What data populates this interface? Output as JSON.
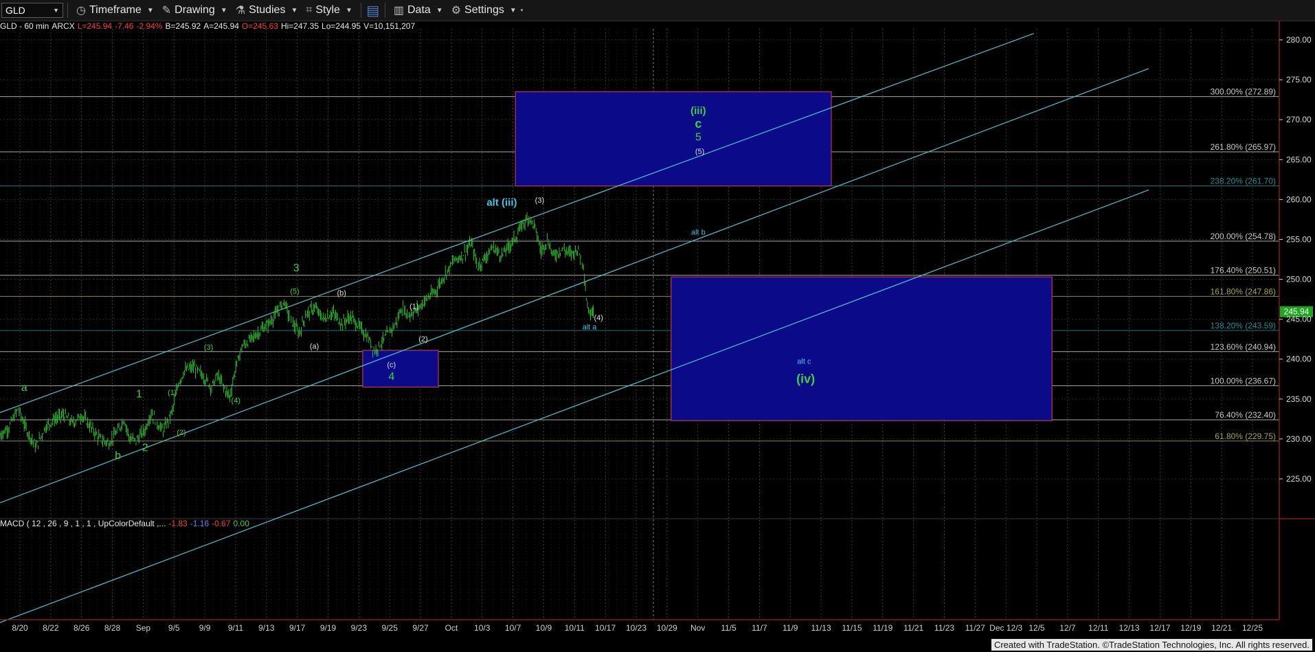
{
  "toolbar": {
    "symbol": "GLD",
    "timeframe": "Timeframe",
    "drawing": "Drawing",
    "studies": "Studies",
    "style": "Style",
    "data": "Data",
    "settings": "Settings"
  },
  "quote": {
    "name": "GLD - 60 min",
    "exchange": "ARCX",
    "last": "L=245.94",
    "change": "-7.46",
    "change_pct": "-2.94%",
    "bid": "B=245.92",
    "ask": "A=245.94",
    "open": "O=245.63",
    "high": "Hi=247.35",
    "low": "Lo=244.95",
    "volume": "V=10,151,207"
  },
  "macd": {
    "label": "MACD ( 12 , 26 , 9 , 1 , 1 , UpColorDefault ,...",
    "v1": "-1.83",
    "v2": "-1.16",
    "v3": "-0.67",
    "v4": "0.00"
  },
  "watermark": "Created with TradeStation. ©TradeStation Technologies, Inc. All rights reserved.",
  "chart_data": {
    "type": "line",
    "symbol": "GLD",
    "interval": "60 min",
    "ylim": [
      220,
      282
    ],
    "y_ticks": [
      "280.00",
      "275.00",
      "270.00",
      "265.00",
      "260.00",
      "255.00",
      "250.00",
      "245.00",
      "240.00",
      "235.00",
      "230.00",
      "225.00"
    ],
    "last_price_label": "245.94",
    "x_tick_labels": [
      "8/20",
      "8/22",
      "8/26",
      "8/28",
      "Sep",
      "9/5",
      "9/9",
      "9/11",
      "9/13",
      "9/17",
      "9/19",
      "9/23",
      "9/25",
      "9/27",
      "Oct",
      "10/3",
      "10/7",
      "10/9",
      "10/11",
      "10/17",
      "10/23",
      "10/29",
      "Nov",
      "11/5",
      "11/7",
      "11/9",
      "11/13",
      "11/15",
      "11/19",
      "11/21",
      "11/23",
      "11/27",
      "Dec 12/3",
      "12/5",
      "12/7",
      "12/11",
      "12/13",
      "12/17",
      "12/19",
      "12/21",
      "12/25"
    ],
    "fib_levels": [
      {
        "label": "300.00% (272.89)",
        "price": 272.89,
        "color": "#c8c8c8"
      },
      {
        "label": "261.80% (265.97)",
        "price": 265.97,
        "color": "#c8c8c8"
      },
      {
        "label": "238.20% (261.70)",
        "price": 261.7,
        "color": "#1f8f8f"
      },
      {
        "label": "200.00% (254.78)",
        "price": 254.78,
        "color": "#c8c8c8"
      },
      {
        "label": "176.40% (250.51)",
        "price": 250.51,
        "color": "#c8c8c8"
      },
      {
        "label": "161.80% (247.86)",
        "price": 247.86,
        "color": "#a6a64a"
      },
      {
        "label": "138.20% (243.59)",
        "price": 243.59,
        "color": "#1f8f8f"
      },
      {
        "label": "123.60% (240.94)",
        "price": 240.94,
        "color": "#c8c8c8"
      },
      {
        "label": "100.00% (236.67)",
        "price": 236.67,
        "color": "#c8c8c8"
      },
      {
        "label": "76.40% (232.40)",
        "price": 232.4,
        "color": "#c8c8c8"
      },
      {
        "label": "61.80% (229.75)",
        "price": 229.75,
        "color": "#a6a64a"
      }
    ],
    "price_path": [
      {
        "t": 0,
        "p": 230.5
      },
      {
        "t": 6,
        "p": 231.5
      },
      {
        "t": 12,
        "p": 233.8
      },
      {
        "t": 18,
        "p": 231.0
      },
      {
        "t": 24,
        "p": 229.0
      },
      {
        "t": 30,
        "p": 231.5
      },
      {
        "t": 36,
        "p": 232.5
      },
      {
        "t": 42,
        "p": 233.0
      },
      {
        "t": 48,
        "p": 232.0
      },
      {
        "t": 54,
        "p": 233.0
      },
      {
        "t": 60,
        "p": 231.5
      },
      {
        "t": 66,
        "p": 230.0
      },
      {
        "t": 72,
        "p": 229.5
      },
      {
        "t": 78,
        "p": 231.0
      },
      {
        "t": 82,
        "p": 232.5
      },
      {
        "t": 86,
        "p": 230.0
      },
      {
        "t": 90,
        "p": 229.8
      },
      {
        "t": 96,
        "p": 231.2
      },
      {
        "t": 100,
        "p": 233.3
      },
      {
        "t": 104,
        "p": 232.0
      },
      {
        "t": 108,
        "p": 231.0
      },
      {
        "t": 114,
        "p": 233.5
      },
      {
        "t": 118,
        "p": 237.0
      },
      {
        "t": 122,
        "p": 238.5
      },
      {
        "t": 128,
        "p": 239.0
      },
      {
        "t": 134,
        "p": 238.0
      },
      {
        "t": 140,
        "p": 236.5
      },
      {
        "t": 144,
        "p": 238.0
      },
      {
        "t": 148,
        "p": 236.5
      },
      {
        "t": 152,
        "p": 235.3
      },
      {
        "t": 156,
        "p": 239.0
      },
      {
        "t": 160,
        "p": 241.5
      },
      {
        "t": 166,
        "p": 242.5
      },
      {
        "t": 172,
        "p": 243.5
      },
      {
        "t": 178,
        "p": 244.5
      },
      {
        "t": 184,
        "p": 246.0
      },
      {
        "t": 188,
        "p": 247.3
      },
      {
        "t": 192,
        "p": 245.0
      },
      {
        "t": 198,
        "p": 243.2
      },
      {
        "t": 202,
        "p": 245.5
      },
      {
        "t": 208,
        "p": 246.5
      },
      {
        "t": 214,
        "p": 245.0
      },
      {
        "t": 220,
        "p": 245.8
      },
      {
        "t": 226,
        "p": 244.5
      },
      {
        "t": 232,
        "p": 245.3
      },
      {
        "t": 238,
        "p": 244.0
      },
      {
        "t": 244,
        "p": 242.5
      },
      {
        "t": 248,
        "p": 241.0
      },
      {
        "t": 252,
        "p": 242.0
      },
      {
        "t": 256,
        "p": 243.0
      },
      {
        "t": 262,
        "p": 244.5
      },
      {
        "t": 266,
        "p": 246.5
      },
      {
        "t": 270,
        "p": 245.5
      },
      {
        "t": 276,
        "p": 246.2
      },
      {
        "t": 282,
        "p": 247.5
      },
      {
        "t": 288,
        "p": 248.5
      },
      {
        "t": 294,
        "p": 250.5
      },
      {
        "t": 300,
        "p": 252.3
      },
      {
        "t": 306,
        "p": 253.0
      },
      {
        "t": 312,
        "p": 254.5
      },
      {
        "t": 316,
        "p": 251.5
      },
      {
        "t": 320,
        "p": 252.5
      },
      {
        "t": 326,
        "p": 254.0
      },
      {
        "t": 332,
        "p": 253.0
      },
      {
        "t": 338,
        "p": 254.5
      },
      {
        "t": 342,
        "p": 255.5
      },
      {
        "t": 346,
        "p": 257.0
      },
      {
        "t": 350,
        "p": 257.8
      },
      {
        "t": 354,
        "p": 256.5
      },
      {
        "t": 358,
        "p": 253.5
      },
      {
        "t": 362,
        "p": 255.0
      },
      {
        "t": 366,
        "p": 253.0
      },
      {
        "t": 372,
        "p": 253.8
      },
      {
        "t": 378,
        "p": 253.2
      },
      {
        "t": 382,
        "p": 253.8
      },
      {
        "t": 386,
        "p": 252.0
      },
      {
        "t": 388,
        "p": 247.5
      },
      {
        "t": 390,
        "p": 245.5
      },
      {
        "t": 392,
        "p": 246.5
      },
      {
        "t": 393,
        "p": 245.94
      }
    ],
    "wave_labels": [
      {
        "text": "a",
        "t": 16,
        "p": 236.0,
        "color": "#3ecf3e",
        "size": 16
      },
      {
        "text": "b",
        "t": 78,
        "p": 227.5,
        "color": "#3ecf3e",
        "size": 16
      },
      {
        "text": "1",
        "t": 92,
        "p": 235.2,
        "color": "#3ecf3e",
        "size": 16
      },
      {
        "text": "2",
        "t": 96,
        "p": 228.5,
        "color": "#3ecf3e",
        "size": 16
      },
      {
        "text": "(1)",
        "t": 114,
        "p": 235.5,
        "color": "#3ecf3e",
        "size": 11
      },
      {
        "text": "(2)",
        "t": 120,
        "p": 230.5,
        "color": "#3ecf3e",
        "size": 11
      },
      {
        "text": "(3)",
        "t": 138,
        "p": 241.2,
        "color": "#3ecf3e",
        "size": 11
      },
      {
        "text": "(4)",
        "t": 156,
        "p": 234.5,
        "color": "#3ecf3e",
        "size": 11
      },
      {
        "text": "3",
        "t": 196,
        "p": 251.0,
        "color": "#3ecf3e",
        "size": 16
      },
      {
        "text": "(5)",
        "t": 195,
        "p": 248.2,
        "color": "#3ecf3e",
        "size": 11
      },
      {
        "text": "(b)",
        "t": 226,
        "p": 248.0,
        "color": "#e0e0e0",
        "size": 11
      },
      {
        "text": "(a)",
        "t": 208,
        "p": 241.3,
        "color": "#e0e0e0",
        "size": 11
      },
      {
        "text": "(c)",
        "t": 259,
        "p": 239.0,
        "color": "#e0e0e0",
        "size": 11
      },
      {
        "text": "4",
        "t": 259,
        "p": 237.4,
        "color": "#3ecf3e",
        "size": 16
      },
      {
        "text": "(1)",
        "t": 274,
        "p": 246.3,
        "color": "#e0e0e0",
        "size": 11
      },
      {
        "text": "(2)",
        "t": 280,
        "p": 242.2,
        "color": "#e0e0e0",
        "size": 11
      },
      {
        "text": "alt (iii)",
        "t": 332,
        "p": 259.2,
        "color": "#3fc6e6",
        "size": 15,
        "bold": true
      },
      {
        "text": "(3)",
        "t": 357,
        "p": 259.6,
        "color": "#e0e0e0",
        "size": 11
      },
      {
        "text": "(iii)",
        "t": 462,
        "p": 270.7,
        "color": "#3ecf3e",
        "size": 15,
        "bold": true
      },
      {
        "text": "c",
        "t": 462,
        "p": 269.0,
        "color": "#3ecf3e",
        "size": 18,
        "bold": true
      },
      {
        "text": "5",
        "t": 462,
        "p": 267.4,
        "color": "#3ecf3e",
        "size": 16
      },
      {
        "text": "(5)",
        "t": 463,
        "p": 265.7,
        "color": "#e0e0e0",
        "size": 11
      },
      {
        "text": "alt b",
        "t": 462,
        "p": 255.6,
        "color": "#3fc6e6",
        "size": 11
      },
      {
        "text": "(4)",
        "t": 396,
        "p": 244.9,
        "color": "#e0e0e0",
        "size": 11
      },
      {
        "text": "alt a",
        "t": 390,
        "p": 243.7,
        "color": "#3fc6e6",
        "size": 11
      },
      {
        "text": "alt c",
        "t": 532,
        "p": 239.4,
        "color": "#3fc6e6",
        "size": 11
      },
      {
        "text": "(iv)",
        "t": 533,
        "p": 237.0,
        "color": "#3ecf3e",
        "size": 18,
        "bold": true
      }
    ],
    "target_boxes": [
      {
        "name": "upper-target-box",
        "t0": 341,
        "t1": 550,
        "p0": 261.7,
        "p1": 273.5
      },
      {
        "name": "lower-target-box",
        "t0": 444,
        "t1": 696,
        "p0": 232.3,
        "p1": 250.3
      },
      {
        "name": "wave4-box",
        "t0": 240,
        "t1": 290,
        "p0": 236.5,
        "p1": 241.1
      }
    ],
    "channel_lines": [
      {
        "t0": 0,
        "p0": 233.3,
        "t1": 684,
        "p1": 280.8
      },
      {
        "t0": 0,
        "p0": 222.0,
        "t1": 760,
        "p1": 276.4
      },
      {
        "t0": 0,
        "p0": 207.0,
        "t1": 760,
        "p1": 261.2
      }
    ]
  }
}
